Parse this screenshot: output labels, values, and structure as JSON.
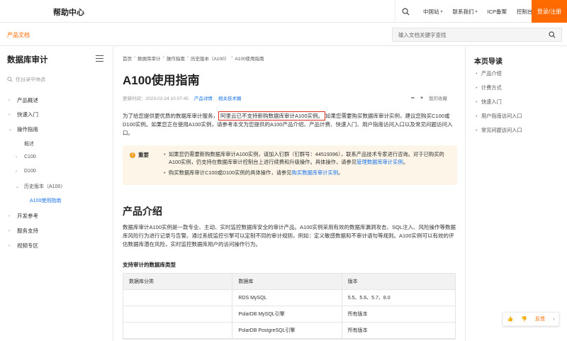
{
  "topbar": {
    "brand": "帮助中心",
    "nav": [
      {
        "label": "中国站",
        "chevron": true
      },
      {
        "label": "联系我们",
        "chevron": true
      },
      {
        "label": "ICP备案",
        "chevron": false
      },
      {
        "label": "控制台",
        "chevron": false
      }
    ],
    "login": "登录/注册"
  },
  "subbar": {
    "product_docs": "产品文档",
    "search_placeholder": "输入文档关键字查找"
  },
  "sidebar": {
    "title": "数据库审计",
    "filter_placeholder": "在目录中筛选",
    "items": [
      {
        "label": "产品概述"
      },
      {
        "label": "快速入门"
      },
      {
        "label": "操作指南"
      },
      {
        "label": "概述"
      },
      {
        "label": "C100"
      },
      {
        "label": "D100"
      },
      {
        "label": "历史版本（A100）"
      },
      {
        "label": "A100使用指南"
      },
      {
        "label": "开发参考"
      },
      {
        "label": "服务支持"
      },
      {
        "label": "视频专区"
      }
    ]
  },
  "breadcrumb": [
    "首页",
    "数据库审计",
    "操作指南",
    "历史版本（A100）",
    "A100使用指南"
  ],
  "article": {
    "title": "A100使用指南",
    "updated": "更新时间：2023-02-24 10:07:45",
    "links": [
      "产品详情",
      "相关技术圈"
    ],
    "my_favorites": "我的收藏",
    "intro_prefix": "为了给您提供更优质的数据库审计服务，",
    "intro_highlight": "阿里云已不支持新购数据库审计A100实例。",
    "intro_suffix": "如果您需要购买数据库审计实例，建议您购买C100或D100实例。如果您正在使用A100实例，请参考本文为您提供的A100产品介绍、产品计费、快速入门、用户指南访问入口以及常见问题访问入口。",
    "notice_label": "重要",
    "notice_1_text": "如果您仍需要新购数据库审计A100实例，请加入钉群（钉群号：44519396），联系产品技术专家进行咨询。对于已购买的A100实例，仍支持在数据库审计控制台上进行续费和升级操作。具体操作，请参见",
    "notice_1_link": "管理数据库审计实例",
    "notice_1_end": "。",
    "notice_2_text": "购买数据库审计C100或D100实例的具体操作，请参见",
    "notice_2_link": "购买数据库审计实例",
    "notice_2_end": "。",
    "section_title": "产品介绍",
    "section_text": "数据库审计A100实例是一款专业、主动、实时监控数据库安全的审计产品。A100实例采用有效的数据库漏洞攻击、SQL注入、风险操作等数据库风险行为进行记录与告警。通过系统监控引擎可以定制不同的审计规则，例如：定义敏感数据和不审计语句等规则。A100实例可以有效的评估数据库潜在风险，实时监控数据库用户的访问操作行为。",
    "table_caption": "支持审计的数据库类型",
    "table_headers": [
      "数据库分类",
      "数据库",
      "版本"
    ],
    "table_rows": [
      [
        "",
        "RDS MySQL",
        "5.5、5.6、5.7、8.0"
      ],
      [
        "",
        "PolarDB MySQL引擎",
        "所有版本"
      ],
      [
        "",
        "PolarDB PostgreSQL引擎",
        "所有版本"
      ]
    ]
  },
  "toc": {
    "title": "本页导读",
    "items": [
      "产品介绍",
      "计费方式",
      "快速入门",
      "用户指南访问入口",
      "常见问题访问入口"
    ]
  },
  "feedback": {
    "label": "反馈"
  },
  "colors": {
    "accent": "#ff6a00",
    "link": "#1a73e8",
    "highlight_border": "#e0301e",
    "notice_bg": "#fdf6e8"
  }
}
